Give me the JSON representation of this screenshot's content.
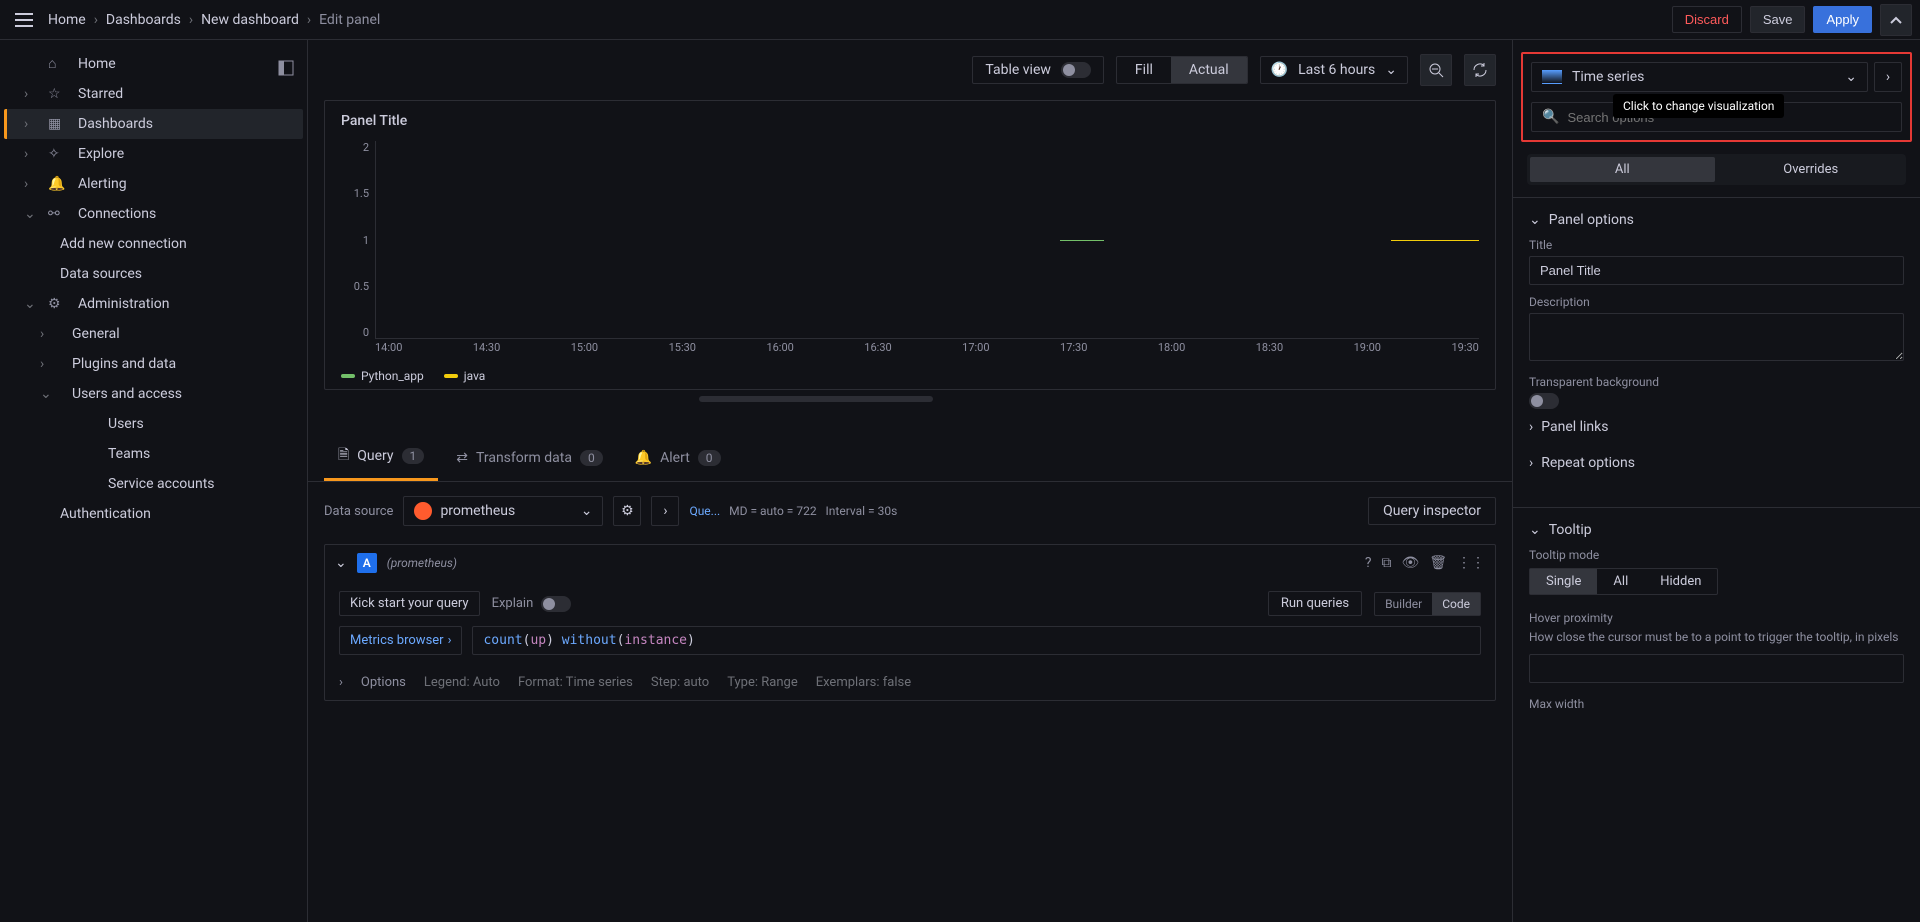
{
  "topbar": {
    "breadcrumb": [
      "Home",
      "Dashboards",
      "New dashboard",
      "Edit panel"
    ],
    "discard": "Discard",
    "save": "Save",
    "apply": "Apply"
  },
  "sidebar": {
    "items": [
      {
        "label": "Home",
        "icon": "home"
      },
      {
        "label": "Starred",
        "icon": "star",
        "expandable": true
      },
      {
        "label": "Dashboards",
        "icon": "dashboards",
        "expandable": true,
        "active": true
      },
      {
        "label": "Explore",
        "icon": "compass",
        "expandable": true
      },
      {
        "label": "Alerting",
        "icon": "bell",
        "expandable": true
      },
      {
        "label": "Connections",
        "icon": "plug",
        "expandable": true,
        "expanded": true
      },
      {
        "label": "Add new connection",
        "sub": 1
      },
      {
        "label": "Data sources",
        "sub": 1
      },
      {
        "label": "Administration",
        "icon": "gear",
        "expandable": true,
        "expanded": true
      },
      {
        "label": "General",
        "sub": 1,
        "expandable": true
      },
      {
        "label": "Plugins and data",
        "sub": 1,
        "expandable": true
      },
      {
        "label": "Users and access",
        "sub": 1,
        "expandable": true,
        "expanded": true
      },
      {
        "label": "Users",
        "sub": 2
      },
      {
        "label": "Teams",
        "sub": 2
      },
      {
        "label": "Service accounts",
        "sub": 2
      },
      {
        "label": "Authentication",
        "sub": 1
      }
    ]
  },
  "toolbar": {
    "table_view": "Table view",
    "fill": "Fill",
    "actual": "Actual",
    "time_range": "Last 6 hours"
  },
  "panel": {
    "title": "Panel Title"
  },
  "chart_data": {
    "type": "line",
    "title": "Panel Title",
    "xlabel": "",
    "ylabel": "",
    "ylim": [
      0,
      2
    ],
    "yticks": [
      0,
      0.5,
      1,
      1.5,
      2
    ],
    "xticks": [
      "14:00",
      "14:30",
      "15:00",
      "15:30",
      "16:00",
      "16:30",
      "17:00",
      "17:30",
      "18:00",
      "18:30",
      "19:00",
      "19:30"
    ],
    "series": [
      {
        "name": "Python_app",
        "color": "#73bf69",
        "values": [
          {
            "x": "17:30",
            "y": 1
          }
        ]
      },
      {
        "name": "java",
        "color": "#f2cc0c",
        "values": [
          {
            "x": "19:30",
            "y": 1
          }
        ]
      }
    ]
  },
  "tabs": {
    "query": "Query",
    "query_count": "1",
    "transform": "Transform data",
    "transform_count": "0",
    "alert": "Alert",
    "alert_count": "0"
  },
  "ds": {
    "label": "Data source",
    "name": "prometheus",
    "que_prefix": "Que...",
    "md": "MD = auto = 722",
    "interval": "Interval = 30s",
    "inspector": "Query inspector"
  },
  "qe": {
    "letter": "A",
    "source": "(prometheus)",
    "kick": "Kick start your query",
    "explain": "Explain",
    "run": "Run queries",
    "builder": "Builder",
    "code": "Code",
    "metrics": "Metrics browser",
    "expr_parts": {
      "fn": "count",
      "p1": "(",
      "kw1": "up",
      "p2": ") ",
      "fn2": "without",
      "p3": "(",
      "kw2": "instance",
      "p4": ")"
    },
    "options": "Options",
    "legend": "Legend: Auto",
    "format": "Format: Time series",
    "step": "Step: auto",
    "type": "Type: Range",
    "exemplars": "Exemplars: false"
  },
  "right": {
    "viz": "Time series",
    "viz_tooltip": "Click to change visualization",
    "search_placeholder": "Search options",
    "tab_all": "All",
    "tab_overrides": "Overrides",
    "panel_options": "Panel options",
    "title_label": "Title",
    "title_value": "Panel Title",
    "desc_label": "Description",
    "transparent": "Transparent background",
    "panel_links": "Panel links",
    "repeat": "Repeat options",
    "tooltip": "Tooltip",
    "tooltip_mode": "Tooltip mode",
    "tm_single": "Single",
    "tm_all": "All",
    "tm_hidden": "Hidden",
    "hover": "Hover proximity",
    "hover_help": "How close the cursor must be to a point to trigger the tooltip, in pixels",
    "max_width": "Max width"
  }
}
